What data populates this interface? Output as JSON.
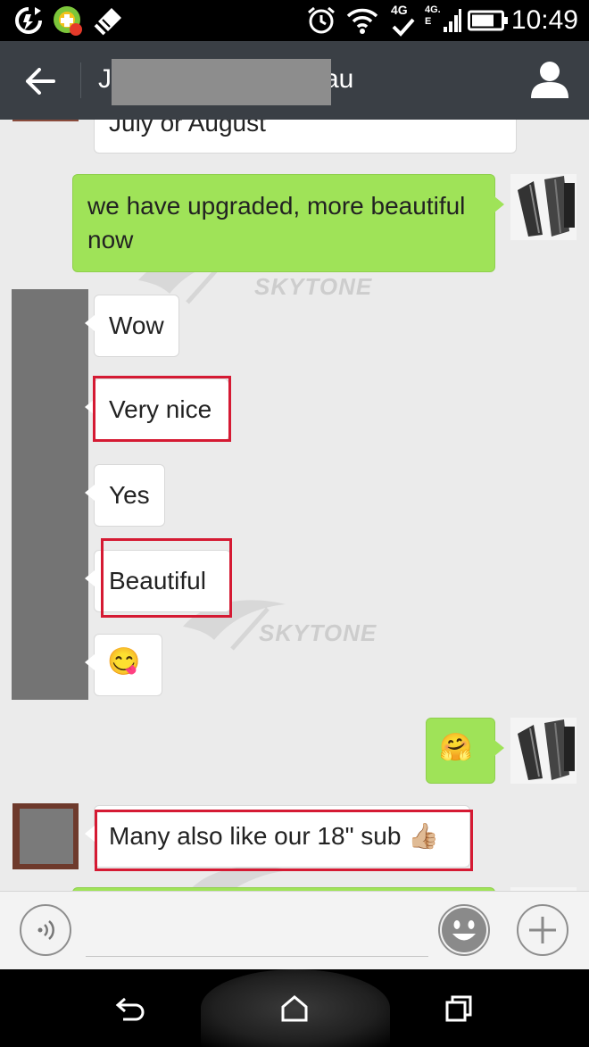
{
  "status_bar": {
    "time": "10:49",
    "network_label": "4G",
    "network_label_2": "4G.",
    "network_label_3": "E",
    "icons": [
      "sync-icon",
      "app-badge-icon",
      "cleaner-icon",
      "alarm-icon",
      "wifi-icon",
      "signal-icon",
      "battery-icon"
    ]
  },
  "header": {
    "title_start": "J",
    "title_end": "au",
    "back_icon": "arrow-left-icon",
    "contact_icon": "person-icon"
  },
  "messages": [
    {
      "side": "in",
      "text": "July or August"
    },
    {
      "side": "out",
      "text": "we have upgraded, more beautiful now"
    },
    {
      "side": "in",
      "text": "Wow"
    },
    {
      "side": "in",
      "text": "Very nice",
      "highlighted": true
    },
    {
      "side": "in",
      "text": "Yes"
    },
    {
      "side": "in",
      "text": "Beautiful",
      "highlighted": true
    },
    {
      "side": "in",
      "emoji": "😋"
    },
    {
      "side": "out",
      "emoji": "🤗"
    },
    {
      "side": "in",
      "text": "Many also like our 18\" sub 👍🏼",
      "highlighted": true
    }
  ],
  "watermark": "SKYTONE",
  "input_bar": {
    "voice_icon": "voice-icon",
    "emoji_icon": "smiley-icon",
    "add_icon": "plus-icon",
    "placeholder": ""
  },
  "nav_bar": {
    "back_icon": "nav-back-icon",
    "home_icon": "home-icon",
    "recents_icon": "recents-icon"
  },
  "colors": {
    "outgoing_bubble": "#9fe358",
    "incoming_bubble": "#ffffff",
    "highlight_box": "#d51a33",
    "action_bar": "#3a3f45"
  }
}
